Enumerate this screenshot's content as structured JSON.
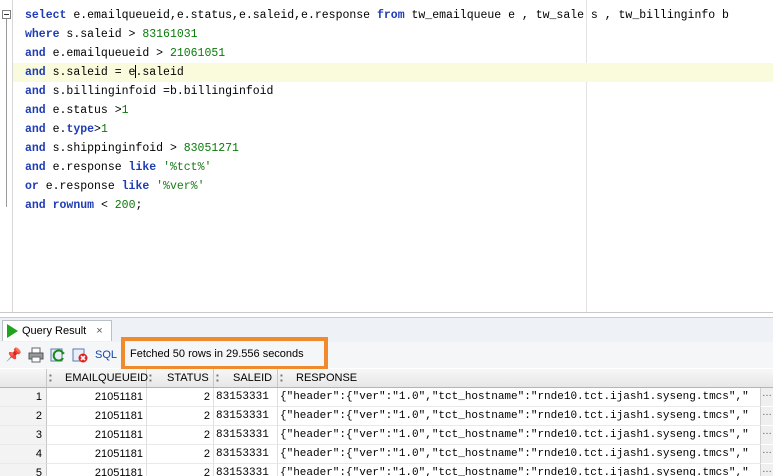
{
  "editor": {
    "sql_lines": [
      [
        {
          "t": "select",
          "k": "kw"
        },
        {
          "t": " e.emailqueueid,e.status,e.saleid,e.response ",
          "k": ""
        },
        {
          "t": "from",
          "k": "kw"
        },
        {
          "t": " tw_emailqueue e , tw_sale s , tw_billinginfo b",
          "k": ""
        }
      ],
      [
        {
          "t": "where",
          "k": "kw"
        },
        {
          "t": " s.saleid > ",
          "k": ""
        },
        {
          "t": "83161031",
          "k": "num"
        }
      ],
      [
        {
          "t": "and",
          "k": "kw"
        },
        {
          "t": " e.emailqueueid > ",
          "k": ""
        },
        {
          "t": "21061051",
          "k": "num"
        }
      ],
      [
        {
          "t": "and",
          "k": "kw"
        },
        {
          "t": " s.saleid = e",
          "k": ""
        },
        {
          "t": "|",
          "k": "caret"
        },
        {
          "t": ".saleid",
          "k": ""
        }
      ],
      [
        {
          "t": "and",
          "k": "kw"
        },
        {
          "t": " s.billinginfoid =b.billinginfoid",
          "k": ""
        }
      ],
      [
        {
          "t": "and",
          "k": "kw"
        },
        {
          "t": " e.status >",
          "k": ""
        },
        {
          "t": "1",
          "k": "num"
        }
      ],
      [
        {
          "t": "and",
          "k": "kw"
        },
        {
          "t": " e.",
          "k": ""
        },
        {
          "t": "type",
          "k": "kw"
        },
        {
          "t": ">",
          "k": ""
        },
        {
          "t": "1",
          "k": "num"
        }
      ],
      [
        {
          "t": "and",
          "k": "kw"
        },
        {
          "t": " s.shippinginfoid > ",
          "k": ""
        },
        {
          "t": "83051271",
          "k": "num"
        }
      ],
      [
        {
          "t": "and",
          "k": "kw"
        },
        {
          "t": " e.response ",
          "k": ""
        },
        {
          "t": "like",
          "k": "kw"
        },
        {
          "t": " ",
          "k": ""
        },
        {
          "t": "'%tct%'",
          "k": "str"
        }
      ],
      [
        {
          "t": "or",
          "k": "kw"
        },
        {
          "t": " e.response ",
          "k": ""
        },
        {
          "t": "like",
          "k": "kw"
        },
        {
          "t": " ",
          "k": ""
        },
        {
          "t": "'%ver%'",
          "k": "str"
        }
      ],
      [
        {
          "t": "and",
          "k": "kw"
        },
        {
          "t": " ",
          "k": ""
        },
        {
          "t": "rownum",
          "k": "kw"
        },
        {
          "t": " < ",
          "k": ""
        },
        {
          "t": "200",
          "k": "num"
        },
        {
          "t": ";",
          "k": ""
        }
      ]
    ],
    "current_line_index": 3
  },
  "results": {
    "tab_label": "Query Result",
    "close_glyph": "×",
    "sql_button_label": "SQL",
    "status_message": "Fetched 50 rows in 29.556 seconds",
    "columns": [
      "EMAILQUEUEID",
      "STATUS",
      "SALEID",
      "RESPONSE"
    ],
    "rows": [
      {
        "n": "1",
        "emailqueueid": "21051181",
        "status": "2",
        "saleid": "83153331",
        "response": "{\"header\":{\"ver\":\"1.0\",\"tct_hostname\":\"rnde10.tct.ijash1.syseng.tmcs\",\""
      },
      {
        "n": "2",
        "emailqueueid": "21051181",
        "status": "2",
        "saleid": "83153331",
        "response": "{\"header\":{\"ver\":\"1.0\",\"tct_hostname\":\"rnde10.tct.ijash1.syseng.tmcs\",\""
      },
      {
        "n": "3",
        "emailqueueid": "21051181",
        "status": "2",
        "saleid": "83153331",
        "response": "{\"header\":{\"ver\":\"1.0\",\"tct_hostname\":\"rnde10.tct.ijash1.syseng.tmcs\",\""
      },
      {
        "n": "4",
        "emailqueueid": "21051181",
        "status": "2",
        "saleid": "83153331",
        "response": "{\"header\":{\"ver\":\"1.0\",\"tct_hostname\":\"rnde10.tct.ijash1.syseng.tmcs\",\""
      },
      {
        "n": "5",
        "emailqueueid": "21051181",
        "status": "2",
        "saleid": "83153331",
        "response": "{\"header\":{\"ver\":\"1.0\",\"tct_hostname\":\"rnde10.tct.ijash1.syseng.tmcs\",\""
      }
    ],
    "ellipsis_glyph": "…"
  },
  "colors": {
    "keyword": "#1e3cb4",
    "number": "#0a7a0a",
    "highlight_border": "#f08a2c",
    "current_line": "#fafadc"
  }
}
